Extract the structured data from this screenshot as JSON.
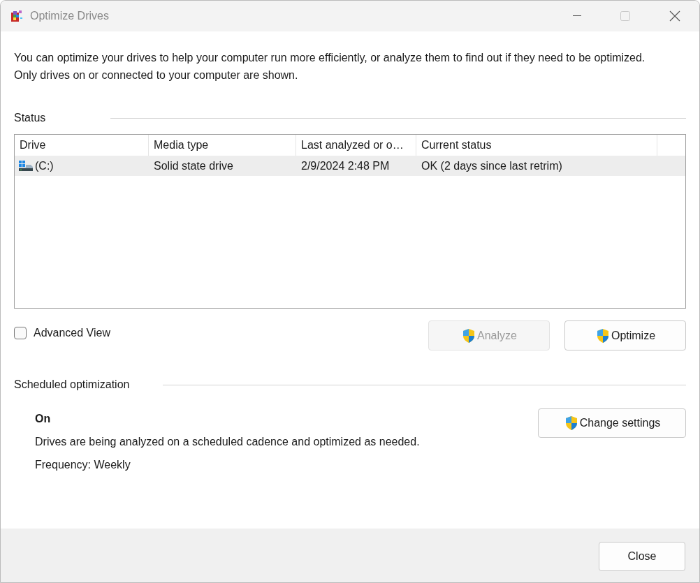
{
  "window": {
    "title": "Optimize Drives"
  },
  "description": "You can optimize your drives to help your computer run more efficiently, or analyze them to find out if they need to be optimized. Only drives on or connected to your computer are shown.",
  "status": {
    "heading": "Status",
    "table": {
      "columns": [
        "Drive",
        "Media type",
        "Last analyzed or o…",
        "Current status"
      ],
      "rows": [
        {
          "selected": true,
          "cells": [
            "(C:)",
            "Solid state drive",
            "2/9/2024 2:48 PM",
            "OK (2 days since last retrim)"
          ]
        }
      ]
    }
  },
  "advanced_view": {
    "label": "Advanced View",
    "checked": false
  },
  "actions": [
    {
      "label": "Analyze",
      "disabled": true
    },
    {
      "label": "Optimize",
      "disabled": false
    }
  ],
  "scheduled": {
    "heading": "Scheduled optimization",
    "state": "On",
    "description": "Drives are being analyzed on a scheduled cadence and optimized as needed.",
    "frequency": "Frequency: Weekly",
    "button": "Change settings"
  },
  "footer": {
    "button": "Close"
  }
}
